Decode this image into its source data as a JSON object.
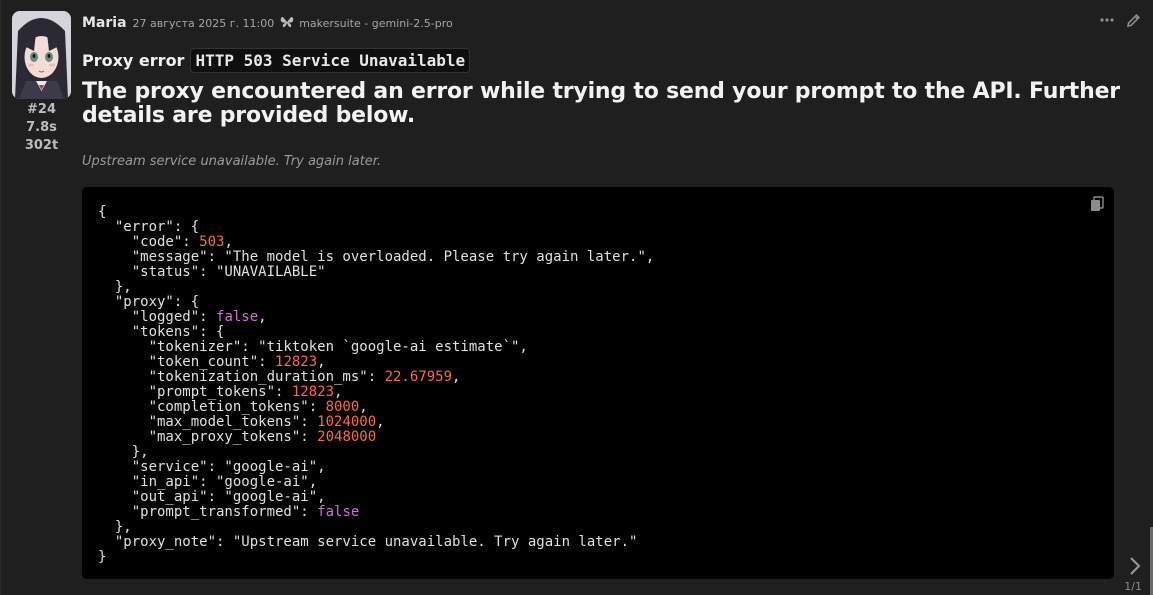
{
  "message": {
    "author": "Maria",
    "timestamp": "27 августа 2025 г. 11:00",
    "model_icon": "butterfly-icon",
    "model": "makersuite - gemini-2.5-pro",
    "index": "#24",
    "duration": "7.8s",
    "tokens": "302t"
  },
  "actions": {
    "more_icon": "ellipsis-icon",
    "edit_icon": "pencil-icon"
  },
  "content": {
    "proxy_label": "Proxy error",
    "status_code": "HTTP 503 Service Unavailable",
    "title": "The proxy encountered an error while trying to send your prompt to the API. Further details are provided below.",
    "note": "Upstream service unavailable. Try again later."
  },
  "json_lines": [
    {
      "t": "{"
    },
    {
      "t": "  \"error\": {"
    },
    {
      "t": "    \"code\": ",
      "v": "503",
      "k": "n",
      "s": ","
    },
    {
      "t": "    \"message\": \"The model is overloaded. Please try again later.\","
    },
    {
      "t": "    \"status\": \"UNAVAILABLE\""
    },
    {
      "t": "  },"
    },
    {
      "t": "  \"proxy\": {"
    },
    {
      "t": "    \"logged\": ",
      "v": "false",
      "k": "b",
      "s": ","
    },
    {
      "t": "    \"tokens\": {"
    },
    {
      "t": "      \"tokenizer\": \"tiktoken `google-ai estimate`\","
    },
    {
      "t": "      \"token_count\": ",
      "v": "12823",
      "k": "n",
      "s": ","
    },
    {
      "t": "      \"tokenization_duration_ms\": ",
      "v": "22.67959",
      "k": "n",
      "s": ","
    },
    {
      "t": "      \"prompt_tokens\": ",
      "v": "12823",
      "k": "n",
      "s": ","
    },
    {
      "t": "      \"completion_tokens\": ",
      "v": "8000",
      "k": "n",
      "s": ","
    },
    {
      "t": "      \"max_model_tokens\": ",
      "v": "1024000",
      "k": "n",
      "s": ","
    },
    {
      "t": "      \"max_proxy_tokens\": ",
      "v": "2048000",
      "k": "n",
      "s": ""
    },
    {
      "t": "    },"
    },
    {
      "t": "    \"service\": \"google-ai\","
    },
    {
      "t": "    \"in_api\": \"google-ai\","
    },
    {
      "t": "    \"out_api\": \"google-ai\","
    },
    {
      "t": "    \"prompt_transformed\": ",
      "v": "false",
      "k": "b",
      "s": ""
    },
    {
      "t": "  },"
    },
    {
      "t": "  \"proxy_note\": \"Upstream service unavailable. Try again later.\""
    },
    {
      "t": "}"
    }
  ],
  "colors": {
    "number": "#ff6b3d",
    "boolean": "#d070d8",
    "background": "#1f1f1f",
    "code_background": "#000000"
  },
  "copy_icon": "copy-icon",
  "nav": {
    "next_icon": "chevron-right-icon",
    "pager": "1/1"
  }
}
